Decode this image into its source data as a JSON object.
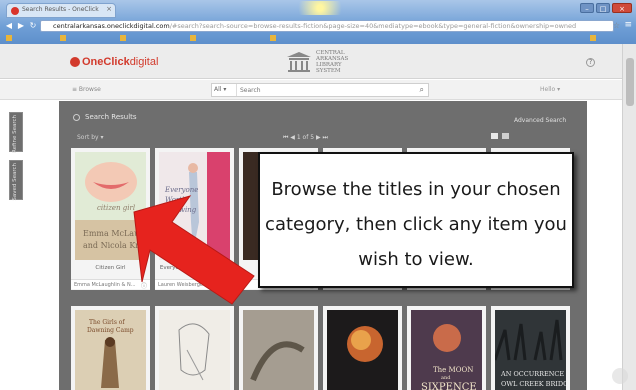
{
  "browser": {
    "tab_title": "Search Results - OneClick",
    "url_host": "centralarkansas.oneclickdigital.com",
    "url_path": "/#search?search-source=browse-results-fiction&page-size=40&mediatype=ebook&type=general-fiction&ownership=owned"
  },
  "site": {
    "logo_brand": "OneClick",
    "logo_suffix": "digital",
    "library_name_lines": [
      "CENTRAL",
      "ARKANSAS",
      "LIBRARY",
      "SYSTEM"
    ],
    "help_glyph": "?"
  },
  "toolbar": {
    "browse_label": "≡ Browse",
    "search_scope": "All ▾",
    "search_placeholder": "Search",
    "user_menu": "Hello ▾"
  },
  "results": {
    "heading": "Search Results",
    "advanced_search": "Advanced Search",
    "sort_label": "Sort by ▾",
    "pager_text": "⏮  ◀   1 of 5   ▶  ⏭"
  },
  "side_tabs": [
    "Refine Search",
    "Saved Search"
  ],
  "books_row1": [
    {
      "title": "Citizen Girl",
      "author": "Emma McLaughlin & N...",
      "cover_bg": "#dbe6cf"
    },
    {
      "title": "Everyone Worth Knowing",
      "author": "Lauren Weisberger",
      "cover_bg": "#ede3e7"
    },
    {
      "title": "",
      "author": "",
      "cover_bg": "#3a2a22"
    },
    {
      "title": "",
      "author": "",
      "cover_bg": "#2b3f58"
    },
    {
      "title": "",
      "author": "",
      "cover_bg": "#c9d7e6"
    },
    {
      "title": "",
      "author": "",
      "cover_bg": "#ebe6b7"
    }
  ],
  "books_row2": [
    {
      "cover_bg": "#d9ccb2",
      "cover_text": "The Girls of Dawning Camp"
    },
    {
      "cover_bg": "#efece6",
      "cover_text": ""
    },
    {
      "cover_bg": "#8d8478",
      "cover_text": ""
    },
    {
      "cover_bg": "#1e1b1c",
      "cover_text": ""
    },
    {
      "cover_bg": "#4e3a4d",
      "cover_text": "The MOON and SIXPENCE"
    },
    {
      "cover_bg": "#303538",
      "cover_text": "AN OCCURRENCE AT OWL CREEK BRIDGE"
    }
  ],
  "callout": {
    "text": "Browse the titles in your chosen category, then click any item you wish to view."
  },
  "colors": {
    "arrow": "#e6231e",
    "panel": "#6e6e6e",
    "brand": "#d23a2c"
  }
}
